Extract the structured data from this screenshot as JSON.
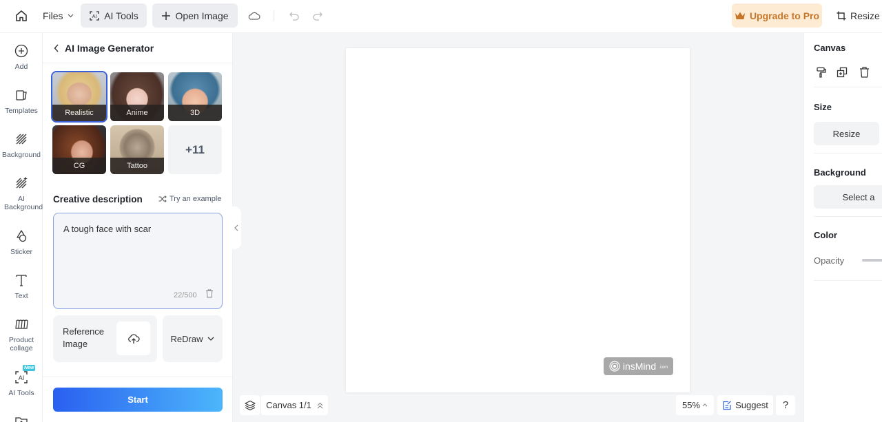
{
  "topbar": {
    "files_label": "Files",
    "ai_tools_label": "AI Tools",
    "open_image_label": "Open Image",
    "upgrade_label": "Upgrade to Pro",
    "resize_label": "Resize",
    "upgrade_color": "#c6762b"
  },
  "rail": {
    "items": [
      {
        "label": "Add",
        "icon": "plus-circle-icon"
      },
      {
        "label": "Templates",
        "icon": "templates-icon"
      },
      {
        "label": "Background",
        "icon": "background-icon"
      },
      {
        "label": "AI Background",
        "icon": "ai-background-icon"
      },
      {
        "label": "Sticker",
        "icon": "sticker-icon"
      },
      {
        "label": "Text",
        "icon": "text-icon"
      },
      {
        "label": "Product collage",
        "icon": "collage-icon"
      },
      {
        "label": "AI Tools",
        "icon": "ai-tools-icon",
        "badge": "New"
      },
      {
        "label": "",
        "icon": "upload-folder-icon"
      }
    ]
  },
  "panel": {
    "title": "AI Image Generator",
    "styles": [
      {
        "label": "Realistic",
        "selected": true
      },
      {
        "label": "Anime",
        "selected": false
      },
      {
        "label": "3D",
        "selected": false
      },
      {
        "label": "CG",
        "selected": false
      },
      {
        "label": "Tattoo",
        "selected": false
      }
    ],
    "more_styles": "+11",
    "description_label": "Creative description",
    "try_example_label": "Try an example",
    "description_value": "A tough face with scar",
    "description_count": "22/500",
    "reference_label": "Reference Image",
    "redraw_label": "ReDraw",
    "start_label": "Start"
  },
  "stage": {
    "watermark": "insMind",
    "watermark_suffix": ".com",
    "canvas_page": "Canvas 1/1",
    "zoom": "55%",
    "suggest_label": "Suggest",
    "help_label": "?"
  },
  "rpanel": {
    "canvas_title": "Canvas",
    "size_title": "Size",
    "resize_label": "Resize",
    "background_title": "Background",
    "select_label": "Select a",
    "color_title": "Color",
    "opacity_label": "Opacity"
  }
}
